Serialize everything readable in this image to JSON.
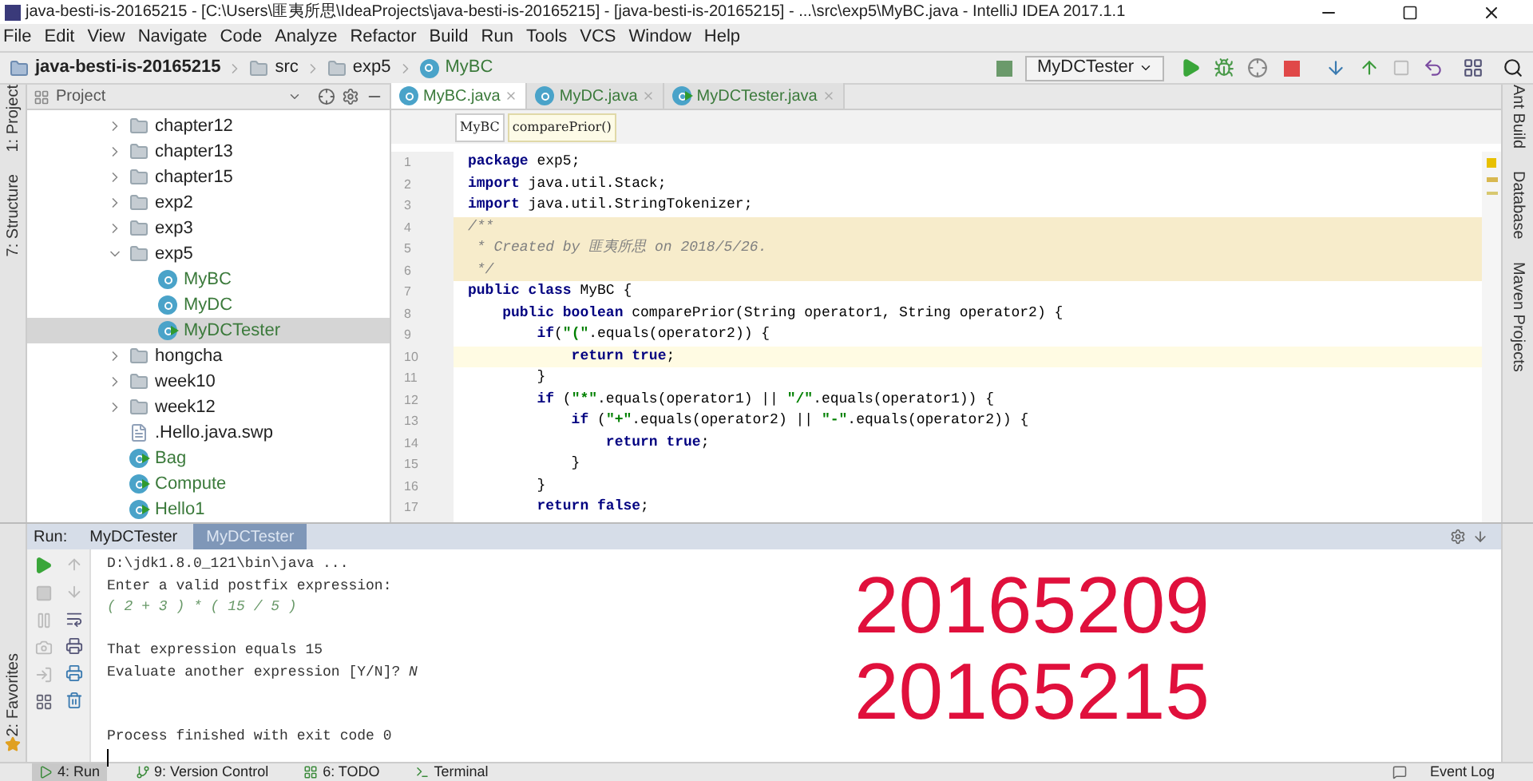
{
  "window": {
    "title": "java-besti-is-20165215 - [C:\\Users\\匪夷所思\\IdeaProjects\\java-besti-is-20165215] - [java-besti-is-20165215] - ...\\src\\exp5\\MyBC.java - IntelliJ IDEA 2017.1.1"
  },
  "menu": [
    "File",
    "Edit",
    "View",
    "Navigate",
    "Code",
    "Analyze",
    "Refactor",
    "Build",
    "Run",
    "Tools",
    "VCS",
    "Window",
    "Help"
  ],
  "nav_path": [
    {
      "label": "java-besti-is-20165215",
      "kind": "project"
    },
    {
      "label": "src",
      "kind": "folder"
    },
    {
      "label": "exp5",
      "kind": "folder"
    },
    {
      "label": "MyBC",
      "kind": "class"
    }
  ],
  "run_config": "MyDCTester",
  "left_stripe": {
    "top": [
      "1: Project",
      "7: Structure"
    ],
    "bottom": [
      "2: Favorites"
    ]
  },
  "right_stripe": [
    "Ant Build",
    "Database",
    "Maven Projects"
  ],
  "project_panel": {
    "title": "Project",
    "items": [
      {
        "label": "chapter12",
        "kind": "folder",
        "expanded": false,
        "selected": false
      },
      {
        "label": "chapter13",
        "kind": "folder",
        "expanded": false,
        "selected": false
      },
      {
        "label": "chapter15",
        "kind": "folder",
        "expanded": false,
        "selected": false
      },
      {
        "label": "exp2",
        "kind": "folder",
        "expanded": false,
        "selected": false
      },
      {
        "label": "exp3",
        "kind": "folder",
        "expanded": false,
        "selected": false
      },
      {
        "label": "exp5",
        "kind": "folder",
        "expanded": true,
        "selected": false,
        "children": [
          {
            "label": "MyBC",
            "kind": "class",
            "selected": false
          },
          {
            "label": "MyDC",
            "kind": "class",
            "selected": false
          },
          {
            "label": "MyDCTester",
            "kind": "main",
            "selected": true
          }
        ]
      },
      {
        "label": "hongcha",
        "kind": "folder",
        "expanded": false,
        "selected": false
      },
      {
        "label": "week10",
        "kind": "folder",
        "expanded": false,
        "selected": false
      },
      {
        "label": "week12",
        "kind": "folder",
        "expanded": false,
        "selected": false
      },
      {
        "label": ".Hello.java.swp",
        "kind": "file",
        "selected": false
      },
      {
        "label": "Bag",
        "kind": "main",
        "selected": false
      },
      {
        "label": "Compute",
        "kind": "main",
        "selected": false
      },
      {
        "label": "Hello1",
        "kind": "main",
        "selected": false
      }
    ]
  },
  "editor": {
    "tabs": [
      {
        "label": "MyBC.java",
        "kind": "class",
        "selected": true
      },
      {
        "label": "MyDC.java",
        "kind": "class",
        "selected": false
      },
      {
        "label": "MyDCTester.java",
        "kind": "main",
        "selected": false
      }
    ],
    "breadcrumb": [
      "MyBC",
      "comparePrior()"
    ],
    "lines": [
      {
        "number": "1",
        "kind": "plain",
        "tokens": [
          {
            "kind": "keyword",
            "text": "package"
          },
          {
            "kind": "plain",
            "text": " exp5;"
          }
        ]
      },
      {
        "number": "2",
        "kind": "plain",
        "tokens": [
          {
            "kind": "keyword",
            "text": "import"
          },
          {
            "kind": "plain",
            "text": " java.util.Stack;"
          }
        ]
      },
      {
        "number": "3",
        "kind": "plain",
        "tokens": [
          {
            "kind": "keyword",
            "text": "import"
          },
          {
            "kind": "plain",
            "text": " java.util.StringTokenizer;"
          }
        ]
      },
      {
        "number": "4",
        "kind": "doc",
        "tokens": [
          {
            "kind": "comment",
            "text": "/**"
          }
        ]
      },
      {
        "number": "5",
        "kind": "doc",
        "tokens": [
          {
            "kind": "comment",
            "text": " * Created by 匪夷所思 on 2018/5/26."
          }
        ]
      },
      {
        "number": "6",
        "kind": "doc",
        "tokens": [
          {
            "kind": "comment",
            "text": " */"
          }
        ]
      },
      {
        "number": "7",
        "kind": "plain",
        "tokens": [
          {
            "kind": "keyword",
            "text": "public class"
          },
          {
            "kind": "plain",
            "text": " MyBC {"
          }
        ]
      },
      {
        "number": "8",
        "kind": "plain",
        "tokens": [
          {
            "kind": "keyword",
            "text": "    public boolean"
          },
          {
            "kind": "plain",
            "text": " comparePrior(String operator1, String operator2) {"
          }
        ]
      },
      {
        "number": "9",
        "kind": "plain",
        "tokens": [
          {
            "kind": "keyword",
            "text": "        if"
          },
          {
            "kind": "plain",
            "text": "("
          },
          {
            "kind": "string",
            "text": "\"(\""
          },
          {
            "kind": "plain",
            "text": ".equals(operator2)) {"
          }
        ]
      },
      {
        "number": "10",
        "kind": "current",
        "tokens": [
          {
            "kind": "keyword",
            "text": "            return true"
          },
          {
            "kind": "plain",
            "text": ";"
          }
        ]
      },
      {
        "number": "11",
        "kind": "plain",
        "tokens": [
          {
            "kind": "plain",
            "text": "        }"
          }
        ]
      },
      {
        "number": "12",
        "kind": "plain",
        "tokens": [
          {
            "kind": "keyword",
            "text": "        if"
          },
          {
            "kind": "plain",
            "text": " ("
          },
          {
            "kind": "string",
            "text": "\"*\""
          },
          {
            "kind": "plain",
            "text": ".equals(operator1) || "
          },
          {
            "kind": "string",
            "text": "\"/\""
          },
          {
            "kind": "plain",
            "text": ".equals(operator1)) {"
          }
        ]
      },
      {
        "number": "13",
        "kind": "plain",
        "tokens": [
          {
            "kind": "keyword",
            "text": "            if"
          },
          {
            "kind": "plain",
            "text": " ("
          },
          {
            "kind": "string",
            "text": "\"+\""
          },
          {
            "kind": "plain",
            "text": ".equals(operator2) || "
          },
          {
            "kind": "string",
            "text": "\"-\""
          },
          {
            "kind": "plain",
            "text": ".equals(operator2)) {"
          }
        ]
      },
      {
        "number": "14",
        "kind": "plain",
        "tokens": [
          {
            "kind": "keyword",
            "text": "                return true"
          },
          {
            "kind": "plain",
            "text": ";"
          }
        ]
      },
      {
        "number": "15",
        "kind": "plain",
        "tokens": [
          {
            "kind": "plain",
            "text": "            }"
          }
        ]
      },
      {
        "number": "16",
        "kind": "plain",
        "tokens": [
          {
            "kind": "plain",
            "text": "        }"
          }
        ]
      },
      {
        "number": "17",
        "kind": "plain",
        "tokens": [
          {
            "kind": "keyword",
            "text": "        return false"
          },
          {
            "kind": "plain",
            "text": ";"
          }
        ]
      }
    ]
  },
  "run_panel": {
    "label": "Run:",
    "tabs": [
      {
        "label": "MyDCTester",
        "selected": false
      },
      {
        "label": "MyDCTester",
        "selected": true
      }
    ],
    "console": [
      {
        "kind": "command",
        "text": "D:\\jdk1.8.0_121\\bin\\java ..."
      },
      {
        "kind": "output",
        "text": "Enter a valid postfix expression:"
      },
      {
        "kind": "input",
        "text": "( 2 + 3 ) * ( 15 / 5 )"
      },
      {
        "kind": "blank"
      },
      {
        "kind": "output",
        "text": "That expression equals 15"
      },
      {
        "kind": "output",
        "text": "Evaluate another expression [Y/N]? *N*"
      },
      {
        "kind": "blank"
      },
      {
        "kind": "blank"
      },
      {
        "kind": "output",
        "text": "Process finished with exit code 0"
      }
    ],
    "overlay_text": [
      "20165209",
      "20165215"
    ]
  },
  "bottom_bar": {
    "tools": [
      {
        "label": "4: Run",
        "kind": "run",
        "selected": true
      },
      {
        "label": "9: Version Control",
        "kind": "vcs",
        "selected": false
      },
      {
        "label": "6: TODO",
        "kind": "todo",
        "selected": false
      },
      {
        "label": "Terminal",
        "kind": "terminal",
        "selected": false
      }
    ],
    "event_log": "Event Log"
  }
}
